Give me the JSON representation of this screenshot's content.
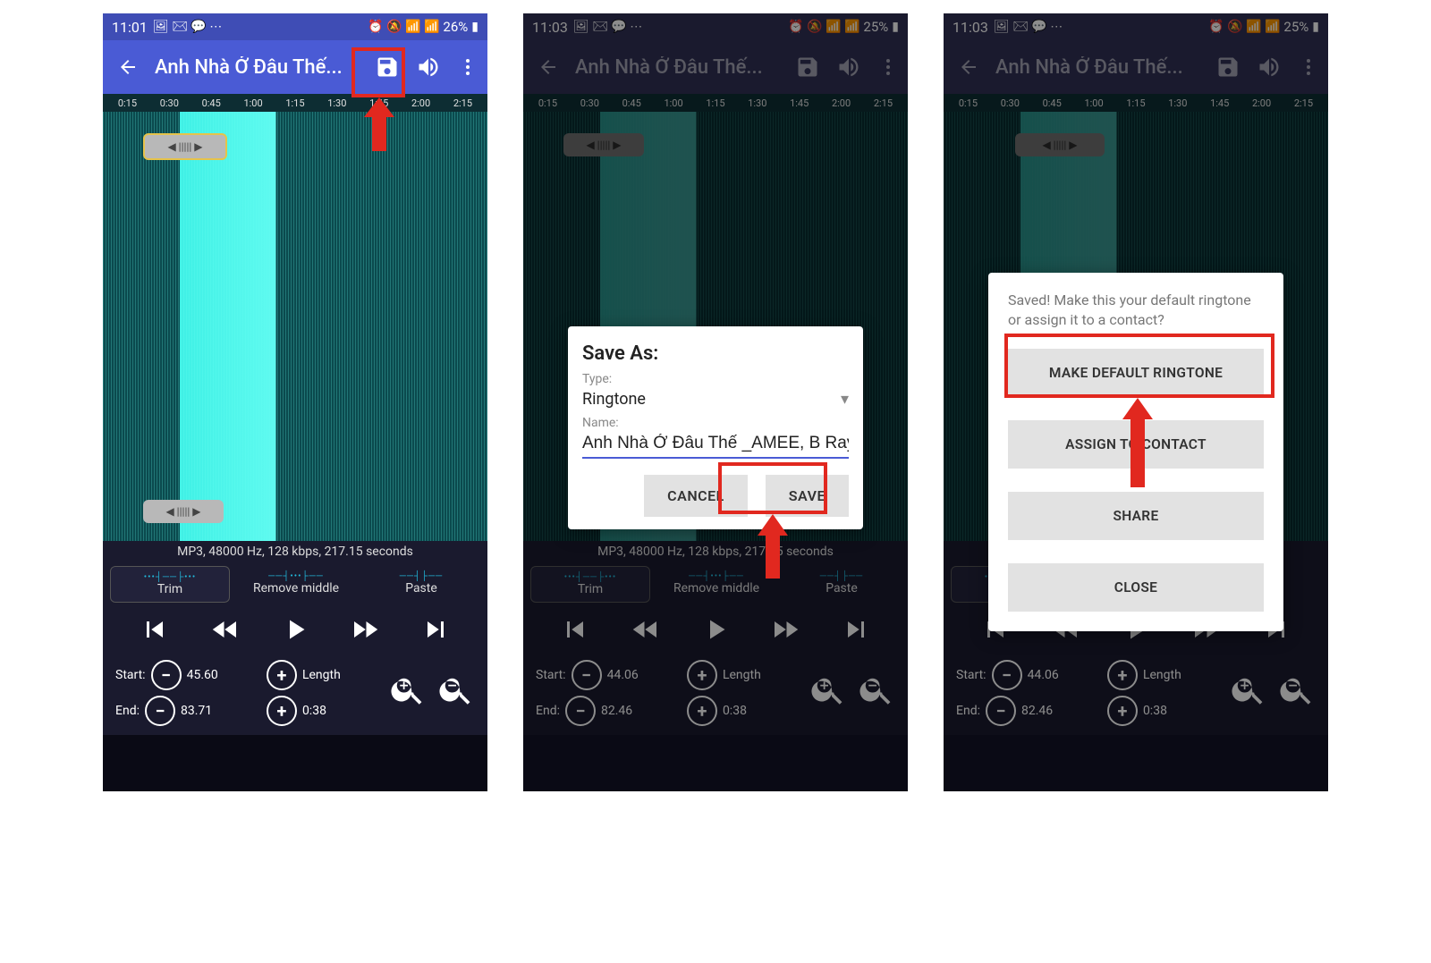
{
  "statusbar": {
    "time_a": "11:01",
    "time_b": "11:03",
    "battery_a": "26%",
    "battery_b": "25%"
  },
  "toolbar": {
    "title": "Anh Nhà Ở Đâu Thế..."
  },
  "ruler": [
    "0:15",
    "0:30",
    "0:45",
    "1:00",
    "1:15",
    "1:30",
    "1:45",
    "2:00",
    "2:15"
  ],
  "file_info": "MP3, 48000 Hz, 128 kbps, 217.15 seconds",
  "tools": {
    "trim": "Trim",
    "remove": "Remove middle",
    "paste": "Paste"
  },
  "range": {
    "start_label": "Start:",
    "end_label": "End:",
    "length_label": "Length",
    "start_a": "45.60",
    "end_a": "83.71",
    "start_b": "44.06",
    "end_b": "82.46",
    "length_val": "0:38"
  },
  "save_dialog": {
    "title": "Save As:",
    "type_label": "Type:",
    "type_value": "Ringtone",
    "name_label": "Name:",
    "name_value": "Anh Nhà Ở Đâu Thế _AMEE, B Ray.",
    "cancel": "CANCEL",
    "save": "SAVE"
  },
  "saved_dialog": {
    "message": "Saved! Make this your default ringtone or assign it to a contact?",
    "opt1": "MAKE DEFAULT RINGTONE",
    "opt2": "ASSIGN TO CONTACT",
    "opt3": "SHARE",
    "opt4": "CLOSE"
  }
}
